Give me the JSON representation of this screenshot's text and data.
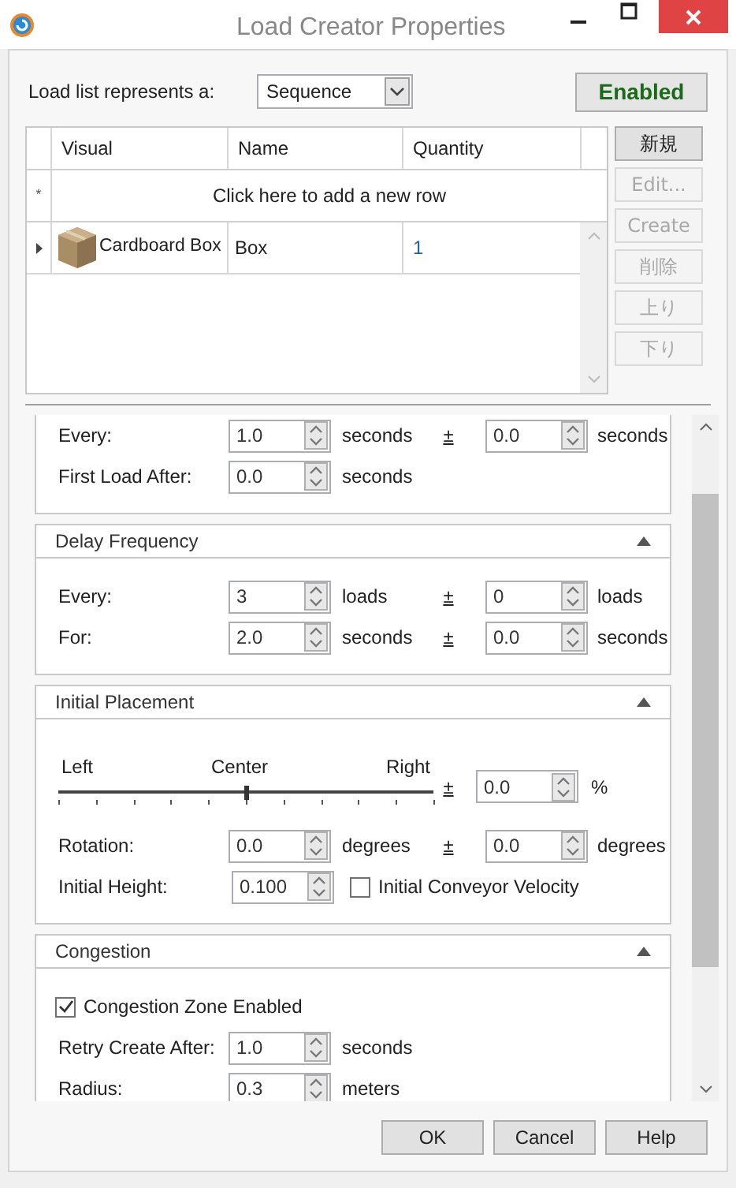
{
  "window": {
    "title": "Load Creator Properties"
  },
  "header": {
    "label": "Load list represents a:",
    "dropdown": "Sequence",
    "toggle": {
      "label": "Enabled",
      "on": true
    }
  },
  "table": {
    "columns": [
      "Visual",
      "Name",
      "Quantity"
    ],
    "new_row_marker": "*",
    "new_row_prompt": "Click here to add a new row",
    "rows": [
      {
        "visual": "Cardboard Box",
        "name": "Box",
        "quantity": "1",
        "selected": false
      }
    ]
  },
  "side_buttons": [
    {
      "label": "新規",
      "disabled": false
    },
    {
      "label": "Edit...",
      "disabled": true
    },
    {
      "label": "Create",
      "disabled": true
    },
    {
      "label": "削除",
      "disabled": true
    },
    {
      "label": "上り",
      "disabled": true
    },
    {
      "label": "下り",
      "disabled": true
    }
  ],
  "sections": [
    {
      "rows": [
        {
          "kind": "spin",
          "label": "Every:",
          "value": "1.0",
          "unit": "seconds",
          "variance": {
            "sign": "±",
            "value": "0.0",
            "unit": "seconds"
          }
        },
        {
          "kind": "spin",
          "label": "First Load After:",
          "value": "0.0",
          "unit": "seconds"
        }
      ]
    },
    {
      "title": "Delay Frequency",
      "expanded": true,
      "rows": [
        {
          "kind": "spin",
          "label": "Every:",
          "value": "3",
          "unit": "loads",
          "variance": {
            "sign": "±",
            "value": "0",
            "unit": "loads"
          }
        },
        {
          "kind": "spin",
          "label": "For:",
          "value": "2.0",
          "unit": "seconds",
          "variance": {
            "sign": "±",
            "value": "0.0",
            "unit": "seconds"
          }
        }
      ]
    },
    {
      "title": "Initial Placement",
      "expanded": true,
      "rows": [
        {
          "kind": "slider",
          "left": "Left",
          "center": "Center",
          "right": "Right",
          "level": 0.5,
          "variance": {
            "sign": "±",
            "value": "0.0",
            "unit": "%"
          }
        },
        {
          "kind": "spin",
          "label": "Rotation:",
          "value": "0.0",
          "unit": "degrees",
          "variance": {
            "sign": "±",
            "value": "0.0",
            "unit": "degrees"
          }
        },
        {
          "kind": "spin_check",
          "label": "Initial Height:",
          "value": "0.100",
          "check": {
            "label": "Initial Conveyor Velocity",
            "checked": false
          }
        }
      ]
    },
    {
      "title": "Congestion",
      "expanded": true,
      "rows": [
        {
          "kind": "check",
          "label": "Congestion Zone Enabled",
          "checked": true
        },
        {
          "kind": "spin",
          "label": "Retry Create After:",
          "value": "1.0",
          "unit": "seconds"
        },
        {
          "kind": "spin",
          "label": "Radius:",
          "value": "0.3",
          "unit": "meters"
        }
      ]
    }
  ],
  "buttons": [
    "OK",
    "Cancel",
    "Help"
  ]
}
